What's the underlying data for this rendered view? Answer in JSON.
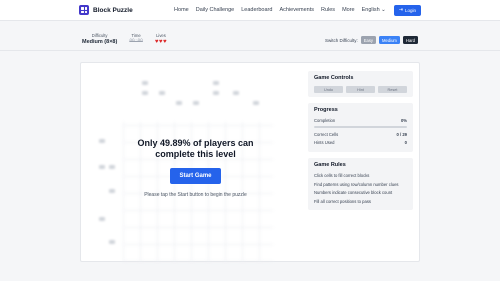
{
  "header": {
    "app_title": "Block Puzzle",
    "nav": [
      "Home",
      "Daily Challenge",
      "Leaderboard",
      "Achievements",
      "Rules",
      "More"
    ],
    "language": "English",
    "login_label": "Login"
  },
  "status": {
    "difficulty_label": "Difficulty",
    "difficulty_value": "Medium (8×8)",
    "time_label": "Time",
    "time_value": "00:00",
    "lives_label": "Lives",
    "lives_count": 3,
    "switch_label": "Switch Difficulty:",
    "options": [
      "Easy",
      "Medium",
      "Hard"
    ],
    "selected_option": "Medium"
  },
  "overlay": {
    "title": "Only 49.89% of players can complete this level",
    "start_label": "Start Game",
    "hint": "Please tap the Start button to begin the puzzle"
  },
  "controls": {
    "title": "Game Controls",
    "buttons": [
      "Undo",
      "Hint",
      "Reset"
    ]
  },
  "progress": {
    "title": "Progress",
    "completion_label": "Completion",
    "completion_value": "0%",
    "completion_fraction": 0,
    "correct_label": "Correct Cells",
    "correct_value": "0 / 29",
    "hints_label": "Hints Used",
    "hints_value": "0"
  },
  "rules": {
    "title": "Game Rules",
    "items": [
      "Click cells to fill correct blocks",
      "Find patterns using row/column number clues",
      "Numbers indicate consecutive block count",
      "Fill all correct positions to pass"
    ]
  },
  "colors": {
    "accent": "#2563eb",
    "lives": "#dc2626",
    "hard": "#1f2937"
  }
}
